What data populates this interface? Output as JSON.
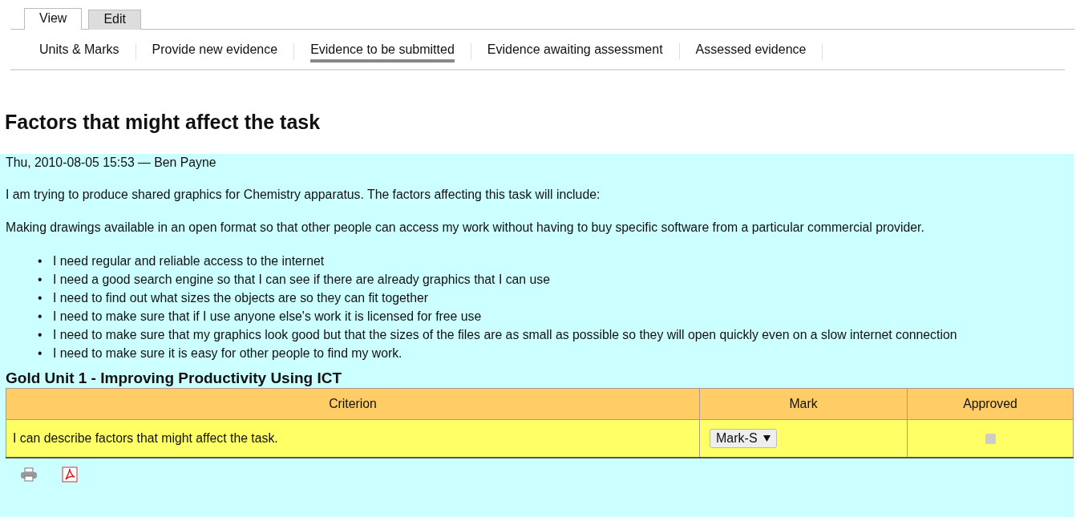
{
  "tabs": [
    {
      "label": "View",
      "selected": true
    },
    {
      "label": "Edit",
      "selected": false
    }
  ],
  "subnav": [
    {
      "label": "Units & Marks",
      "selected": false
    },
    {
      "label": "Provide new evidence",
      "selected": false
    },
    {
      "label": "Evidence to be submitted",
      "selected": true
    },
    {
      "label": "Evidence awaiting assessment",
      "selected": false
    },
    {
      "label": "Assessed evidence",
      "selected": false
    }
  ],
  "title": "Factors that might affect the task",
  "post": {
    "meta": "Thu, 2010-08-05 15:53 — Ben Payne",
    "paragraphs": [
      "I am trying to produce shared graphics for Chemistry apparatus. The factors affecting this task will include:",
      "Making drawings available in an open format so that other people can access my work without having to buy specific software from a particular commercial provider."
    ],
    "bullets": [
      {
        "marker": "•",
        "text": "I need regular and reliable access to the internet"
      },
      {
        "marker": "•",
        "text": "I need a good search engine so that I can see if there are already graphics that I can use"
      },
      {
        "marker": "•",
        "text": "I need to find out what sizes the objects are so they can fit together"
      },
      {
        "marker": "•",
        "text": "I need to make sure that if I use anyone else's work it is licensed for free use"
      },
      {
        "marker": "•",
        "text": "I need to make sure that my graphics look good but that the sizes of the files are as small as possible so they will open quickly even on a slow internet connection"
      },
      {
        "marker": "•",
        "text": "I need to make sure it is easy for other people to find my work."
      }
    ]
  },
  "unit": {
    "heading": "Gold Unit 1 - Improving Productivity Using ICT",
    "columns": [
      "Criterion",
      "Mark",
      "Approved"
    ],
    "rows": [
      {
        "criterion": "I can describe factors that might affect the task.",
        "mark": "Mark-S",
        "approved": false,
        "approved_disabled": true
      }
    ]
  }
}
